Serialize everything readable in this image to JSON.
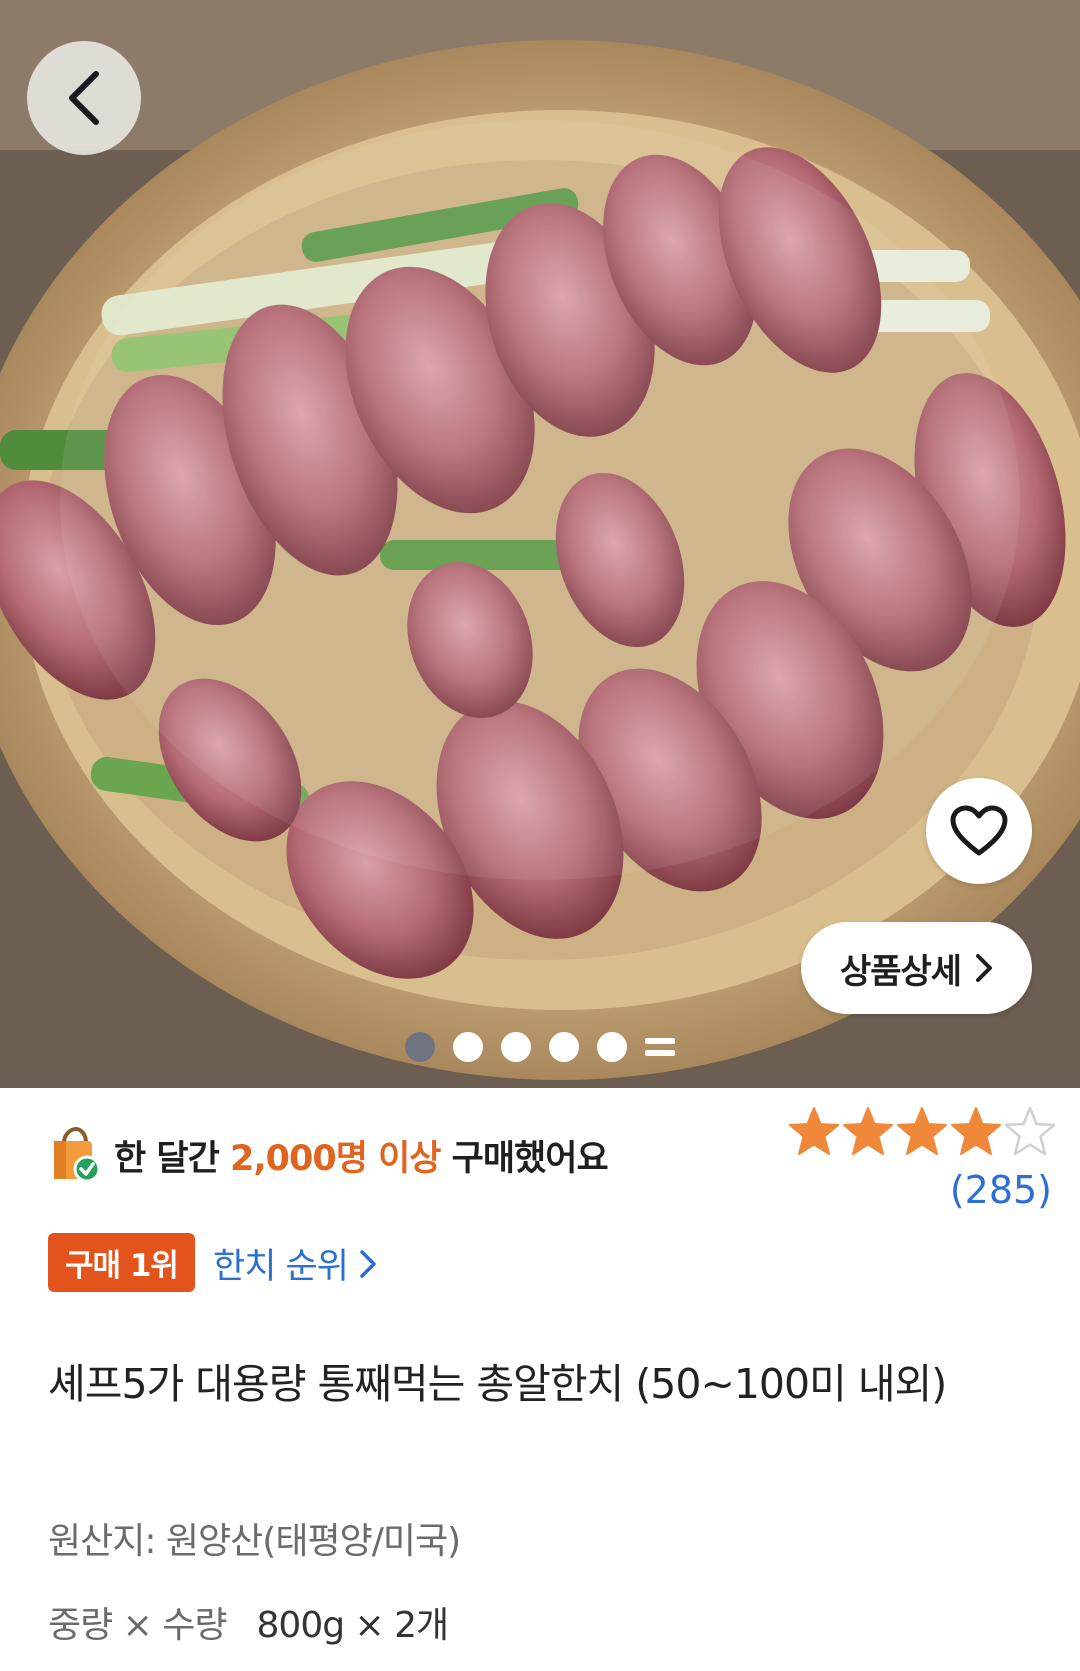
{
  "product": {
    "image_alt": "한치",
    "title": "셰프5가 대용량 통째먹는 총알한치 (50~100미 내외)",
    "origin": "원산지: 원양산(태평양/미국)",
    "spec_label": "중량 × 수량",
    "spec_value": "800g × 2개"
  },
  "hero": {
    "detail_button_label": "상품상세",
    "carousel": {
      "total_dots": 5,
      "active_index": 0
    }
  },
  "purchase_stats": {
    "prefix": "한 달간 ",
    "highlight": "2,000명 이상",
    "suffix": " 구매했어요"
  },
  "rating": {
    "stars": 4,
    "max_stars": 5,
    "count": "(285)"
  },
  "rank": {
    "badge": "구매 1위",
    "link_label": "한치 순위"
  },
  "colors": {
    "accent_orange": "#e0641e",
    "badge_orange": "#e3531c",
    "link_blue": "#2b6fd6",
    "star": "#f0883a"
  },
  "icons": [
    "back-arrow-icon",
    "heart-icon",
    "chevron-right-icon",
    "shopping-bag-icon",
    "star-icon"
  ]
}
